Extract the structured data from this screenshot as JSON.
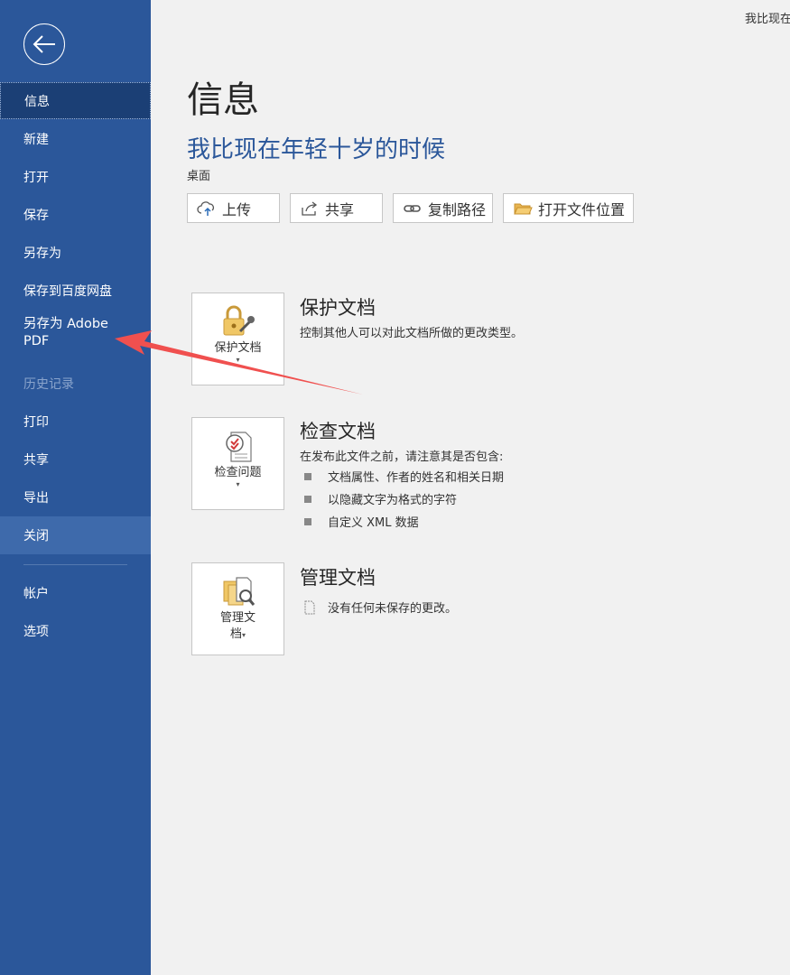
{
  "window": {
    "title_fragment": "我比现在"
  },
  "sidebar": {
    "back_label": "返回",
    "items": [
      {
        "label": "信息",
        "state": "selected"
      },
      {
        "label": "新建"
      },
      {
        "label": "打开"
      },
      {
        "label": "保存"
      },
      {
        "label": "另存为"
      },
      {
        "label": "保存到百度网盘"
      },
      {
        "label": "另存为 Adobe PDF"
      },
      {
        "label": "历史记录",
        "state": "disabled"
      },
      {
        "label": "打印"
      },
      {
        "label": "共享"
      },
      {
        "label": "导出"
      },
      {
        "label": "关闭",
        "state": "hover"
      },
      {
        "label": "帐户"
      },
      {
        "label": "选项"
      }
    ]
  },
  "main": {
    "page_title": "信息",
    "doc_title": "我比现在年轻十岁的时候",
    "doc_location": "桌面",
    "actions": [
      {
        "label": "上传",
        "icon": "cloud-upload-icon"
      },
      {
        "label": "共享",
        "icon": "share-icon"
      },
      {
        "label": "复制路径",
        "icon": "link-icon"
      },
      {
        "label": "打开文件位置",
        "icon": "folder-icon"
      }
    ],
    "sections": {
      "protect": {
        "button_label": "保护文档",
        "title": "保护文档",
        "description": "控制其他人可以对此文档所做的更改类型。"
      },
      "inspect": {
        "button_label": "检查问题",
        "title": "检查文档",
        "description": "在发布此文件之前，请注意其是否包含:",
        "bullets": [
          "文档属性、作者的姓名和相关日期",
          "以隐藏文字为格式的字符",
          "自定义 XML 数据"
        ]
      },
      "manage": {
        "button_label_line1": "管理文",
        "button_label_line2": "档",
        "title": "管理文档",
        "description": "没有任何未保存的更改。"
      }
    }
  },
  "annotation": {
    "arrow_color": "#f0504f"
  },
  "colors": {
    "sidebar_bg": "#2b579a",
    "accent": "#2b579a",
    "page_bg": "#f1f1f1"
  }
}
